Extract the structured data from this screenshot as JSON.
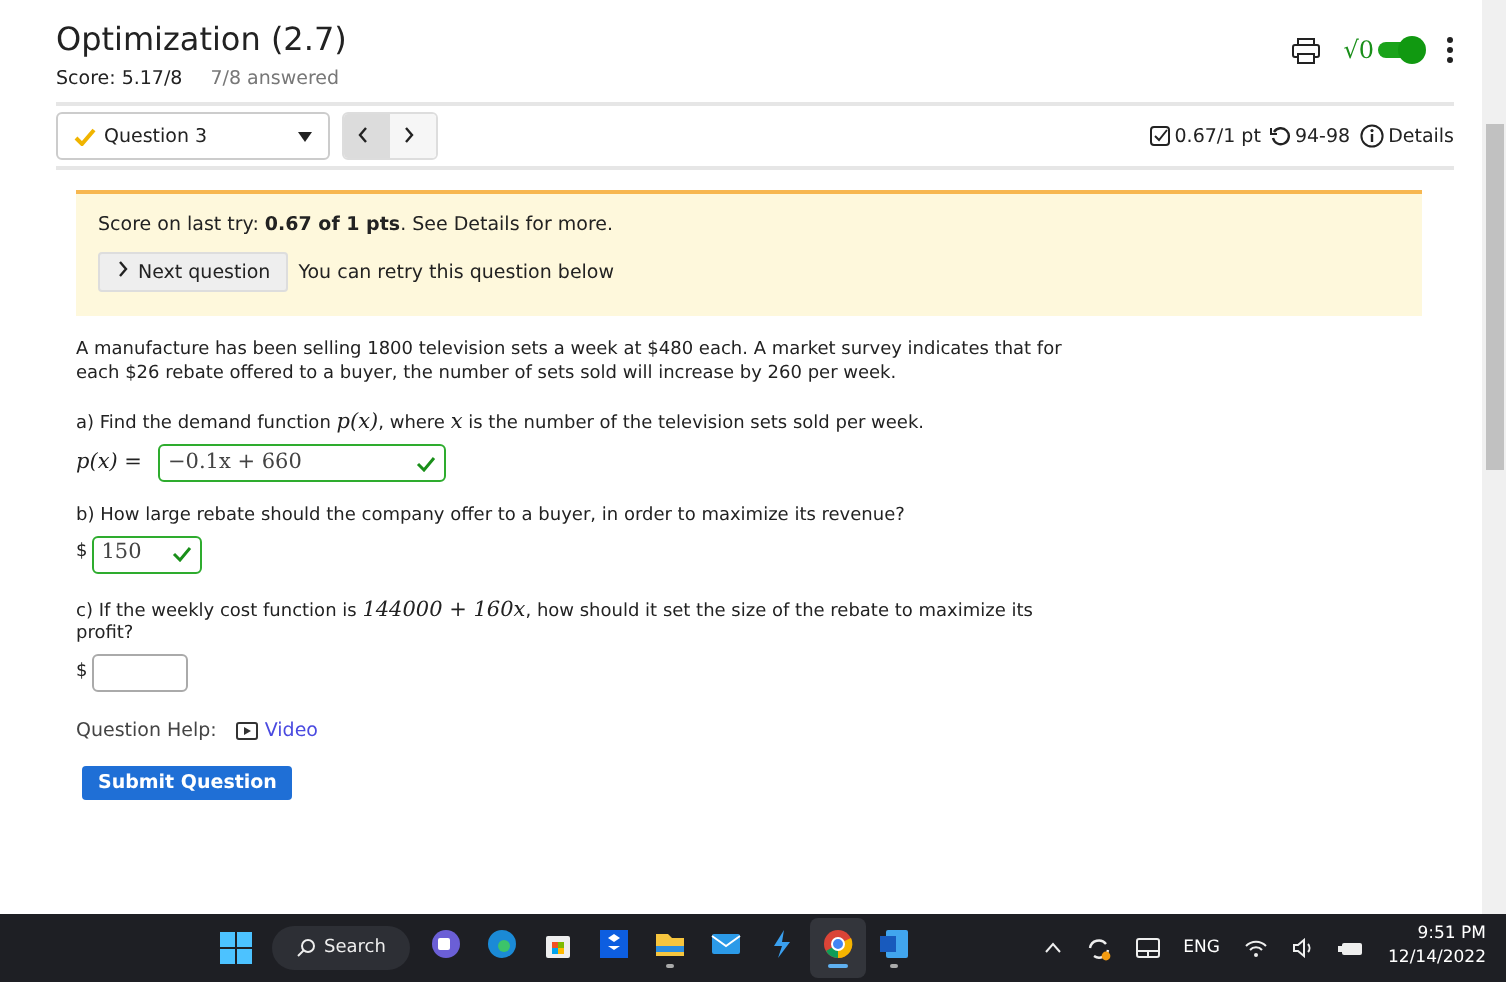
{
  "header": {
    "title": "Optimization (2.7)",
    "score": "Score: 5.17/8",
    "answered": "7/8 answered",
    "math_toggle": {
      "label": "√0",
      "on": true
    }
  },
  "toolbar": {
    "question_select": "Question 3",
    "partial_credit": true,
    "score": "0.67/1 pt",
    "retries": "94-98",
    "details": "Details"
  },
  "notice": {
    "score_text": "Score on last try: **0.67 of 1 pts**. See Details for more.",
    "next_button": "Next question",
    "retry_text": "You can retry this question below"
  },
  "problem": "A manufacture has been selling 1800 television sets a week at $480 each. A market survey indicates that for each $26 rebate offered to a buyer, the number of sets sold will increase by 260 per week.",
  "parts": [
    {
      "question": [
        "a) Find the demand function ",
        "p(x)",
        ", where ",
        "x",
        " is the number of the television sets sold per week."
      ],
      "prefix": "p(x) =",
      "answer": "−0.1x + 660",
      "correct": true
    },
    {
      "question": [
        "b) How large rebate should the company offer to a buyer, in order to maximize its revenue?"
      ],
      "prefix": "$",
      "answer": "150",
      "correct": true
    },
    {
      "question": [
        "c) If the weekly cost function is ",
        "144000 + 160x",
        ", how should it set the size of the rebate to maximize its profit?"
      ],
      "prefix": "$",
      "correct": false
    }
  ],
  "help": {
    "label": "Question Help:",
    "video": "Video"
  },
  "submit": "Submit Question",
  "taskbar": {
    "search": "Search",
    "apps": [
      {
        "kind": "chat",
        "running": false
      },
      {
        "kind": "browser",
        "running": false
      },
      {
        "kind": "store",
        "running": false
      },
      {
        "kind": "box",
        "running": false
      },
      {
        "kind": "folder",
        "running": true
      },
      {
        "kind": "mail",
        "running": false
      },
      {
        "kind": "bolt",
        "running": false
      },
      {
        "kind": "chrome",
        "running": true
      },
      {
        "kind": "word",
        "running": true
      }
    ],
    "language": "ENG",
    "time": "9:51 PM",
    "date": "12/14/2022"
  }
}
